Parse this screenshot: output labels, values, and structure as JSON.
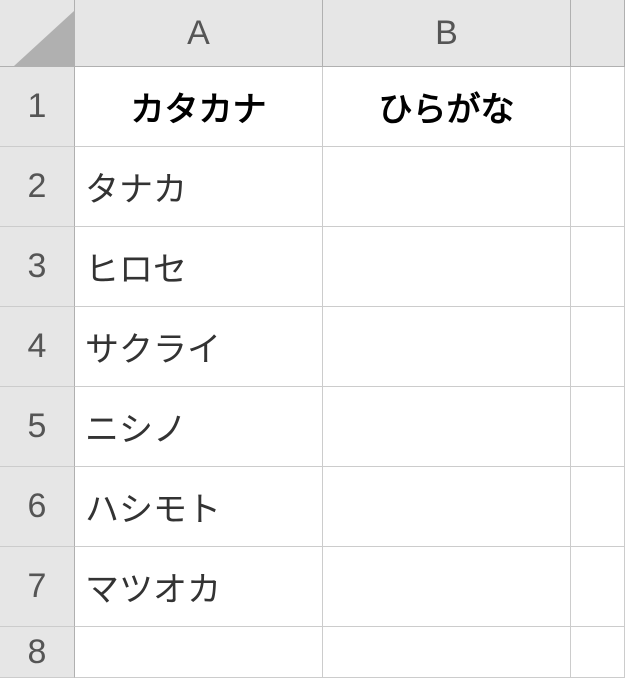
{
  "columns": [
    "A",
    "B"
  ],
  "rows": [
    "1",
    "2",
    "3",
    "4",
    "5",
    "6",
    "7",
    "8"
  ],
  "chart_data": {
    "type": "table",
    "headers": {
      "A": "カタカナ",
      "B": "ひらがな"
    },
    "data": {
      "A2": "タナカ",
      "A3": "ヒロセ",
      "A4": "サクライ",
      "A5": "ニシノ",
      "A6": "ハシモト",
      "A7": "マツオカ"
    }
  }
}
